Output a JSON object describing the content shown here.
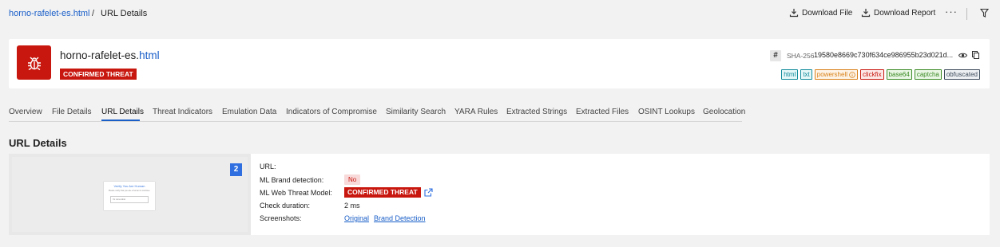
{
  "breadcrumb": {
    "link": "horno-rafelet-es.html",
    "separator": "/",
    "current": "URL Details"
  },
  "toolbar": {
    "download_file": "Download File",
    "download_report": "Download Report",
    "more": "···"
  },
  "header": {
    "title_base": "horno-rafelet-es.",
    "title_ext": "html",
    "verdict": "CONFIRMED THREAT",
    "hash_symbol": "#",
    "sha_label": "SHA-256",
    "sha_value": "19580e8669c730f634ce986955b23d021d...",
    "tags": [
      {
        "label": "html",
        "color": "#0e8a9a",
        "bg": "#e6f7f8"
      },
      {
        "label": "txt",
        "color": "#0e8a9a",
        "bg": "#e6f7f8"
      },
      {
        "label": "powershell",
        "color": "#d9821a",
        "bg": "#fdf3e6",
        "icon": "info-icon"
      },
      {
        "label": "clickfix",
        "color": "#c8170e",
        "bg": "#fce8e7"
      },
      {
        "label": "base64",
        "color": "#3a8a24",
        "bg": "#e9f6e4"
      },
      {
        "label": "captcha",
        "color": "#3a8a24",
        "bg": "#e9f6e4"
      },
      {
        "label": "obfuscated",
        "color": "#3b4a5a",
        "bg": "#eef1f4"
      }
    ]
  },
  "tabs": [
    {
      "label": "Overview"
    },
    {
      "label": "File Details"
    },
    {
      "label": "URL Details",
      "active": true
    },
    {
      "label": "Threat Indicators"
    },
    {
      "label": "Emulation Data"
    },
    {
      "label": "Indicators of Compromise"
    },
    {
      "label": "Similarity Search"
    },
    {
      "label": "YARA Rules"
    },
    {
      "label": "Extracted Strings"
    },
    {
      "label": "Extracted Files"
    },
    {
      "label": "OSINT Lookups"
    },
    {
      "label": "Geolocation"
    }
  ],
  "section_title": "URL Details",
  "details": {
    "screenshot_count": "2",
    "preview": {
      "title": "Verify You Are Human",
      "text": "Please verify that you are a human to continue.",
      "box": "I'm not a robot"
    },
    "url_label": "URL:",
    "brand_label": "ML Brand detection:",
    "brand_value": "No",
    "web_threat_label": "ML Web Threat Model:",
    "web_threat_value": "CONFIRMED THREAT",
    "duration_label": "Check duration:",
    "duration_value": "2 ms",
    "screenshots_label": "Screenshots:",
    "screenshot_links": [
      "Original",
      "Brand Detection"
    ]
  },
  "colors": {
    "threat_red": "#c8170e",
    "link_blue": "#1a5fc8",
    "badge_blue": "#2f6fe0"
  }
}
